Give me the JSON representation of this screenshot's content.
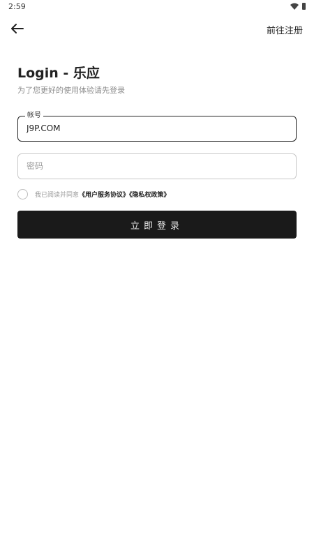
{
  "status_bar": {
    "time": "2:59",
    "icons": [
      "wifi-icon",
      "battery-icon"
    ]
  },
  "header": {
    "back_icon": "arrow-left-icon",
    "register_link": "前往注册"
  },
  "login": {
    "title": "Login - 乐应",
    "subtitle": "为了您更好的使用体验请先登录",
    "account": {
      "label": "帐号",
      "value": "J9P.COM"
    },
    "password": {
      "placeholder": "密码"
    },
    "agreement": {
      "text": "我已阅读并同意",
      "user_agreement": "《用户服务协议》",
      "privacy_policy": "《隐私权政策》"
    },
    "submit_label": "立即登录"
  },
  "colors": {
    "button_bg": "#1a1a1a",
    "muted_text": "#9a9a9a",
    "focused_border": "#222222"
  }
}
